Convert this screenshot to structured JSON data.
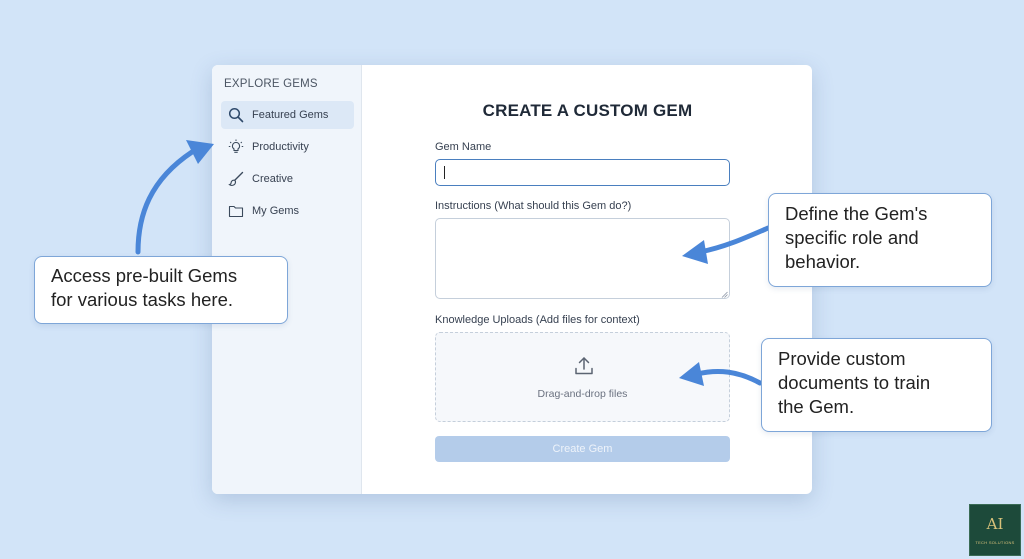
{
  "sidebar": {
    "title": "EXPLORE GEMS",
    "items": [
      {
        "label": "Featured Gems",
        "icon": "search-icon"
      },
      {
        "label": "Productivity",
        "icon": "lightbulb-icon"
      },
      {
        "label": "Creative",
        "icon": "brush-icon"
      },
      {
        "label": "My Gems",
        "icon": "folder-icon"
      }
    ]
  },
  "form": {
    "title": "CREATE A CUSTOM GEM",
    "name_label": "Gem Name",
    "name_value": "",
    "instructions_label": "Instructions (What should this Gem do?)",
    "instructions_value": "",
    "uploads_label": "Knowledge Uploads (Add files for context)",
    "dropzone_text": "Drag-and-drop files",
    "submit_label": "Create Gem"
  },
  "callouts": {
    "left": [
      "Access pre-built Gems",
      "for various tasks here."
    ],
    "right_top": [
      "Define the Gem's",
      "specific role and",
      "behavior."
    ],
    "right_bottom": [
      "Provide custom",
      "documents to train",
      "the Gem."
    ]
  },
  "logo": {
    "mark": "AI",
    "subtitle": "TECH SOLUTIONS"
  },
  "colors": {
    "background": "#d2e4f8",
    "accent": "#4a86d8",
    "button_disabled": "#b4ccea"
  }
}
